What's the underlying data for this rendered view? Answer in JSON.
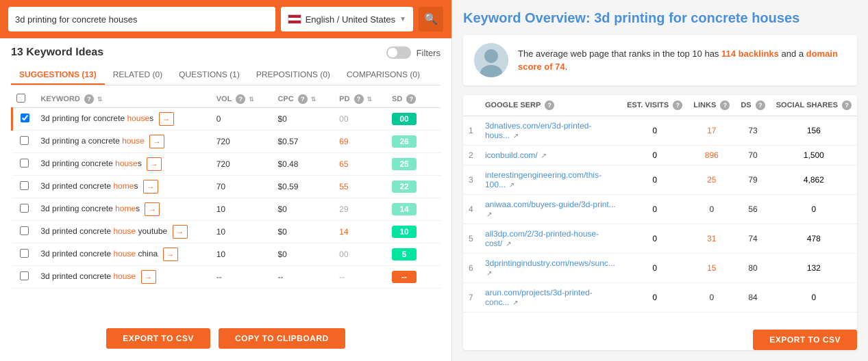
{
  "search": {
    "query": "3d printing for concrete houses",
    "lang": "English / United States",
    "placeholder": "3d printing for concrete houses"
  },
  "left": {
    "keyword_count": "13 Keyword Ideas",
    "filters_label": "Filters",
    "tabs": [
      {
        "id": "suggestions",
        "label": "SUGGESTIONS (13)",
        "active": true
      },
      {
        "id": "related",
        "label": "RELATED (0)",
        "active": false
      },
      {
        "id": "questions",
        "label": "QUESTIONS (1)",
        "active": false
      },
      {
        "id": "prepositions",
        "label": "PREPOSITIONS (0)",
        "active": false
      },
      {
        "id": "comparisons",
        "label": "COMPARISONS (0)",
        "active": false
      }
    ],
    "table_headers": [
      {
        "id": "keyword",
        "label": "KEYWORD"
      },
      {
        "id": "vol",
        "label": "VOL"
      },
      {
        "id": "cpc",
        "label": "CPC"
      },
      {
        "id": "pd",
        "label": "PD"
      },
      {
        "id": "sd",
        "label": "SD"
      }
    ],
    "rows": [
      {
        "keyword": "3d printing for concrete houses",
        "vol": "0",
        "cpc": "$0",
        "pd": "00",
        "sd": "00",
        "pd_style": "gray",
        "sd_style": "teal",
        "selected": true,
        "active_row": true
      },
      {
        "keyword": "3d printing a concrete house",
        "vol": "720",
        "cpc": "$0.57",
        "pd": "69",
        "sd": "26",
        "pd_style": "orange",
        "sd_style": "light-teal"
      },
      {
        "keyword": "3d printing concrete houses",
        "vol": "720",
        "cpc": "$0.48",
        "pd": "65",
        "sd": "25",
        "pd_style": "orange",
        "sd_style": "light-teal"
      },
      {
        "keyword": "3d printed concrete homes",
        "vol": "70",
        "cpc": "$0.59",
        "pd": "55",
        "sd": "22",
        "pd_style": "orange",
        "sd_style": "light-teal"
      },
      {
        "keyword": "3d printing concrete homes",
        "vol": "10",
        "cpc": "$0",
        "pd": "29",
        "sd": "14",
        "pd_style": "gray",
        "sd_style": "light-teal"
      },
      {
        "keyword": "3d printed concrete house youtube",
        "vol": "10",
        "cpc": "$0",
        "pd": "14",
        "sd": "10",
        "pd_style": "orange",
        "sd_style": "teal-bright"
      },
      {
        "keyword": "3d printed concrete house china",
        "vol": "10",
        "cpc": "$0",
        "pd": "00",
        "sd": "5",
        "pd_style": "gray",
        "sd_style": "teal-bright"
      },
      {
        "keyword": "3d printed concrete house",
        "vol": "--",
        "cpc": "--",
        "pd": "--",
        "sd": "--",
        "pd_style": "gray",
        "sd_style": "orange"
      }
    ],
    "export_csv": "EXPORT TO CSV",
    "copy_clipboard": "COPY TO CLIPBOARD"
  },
  "right": {
    "title_static": "Keyword Overview:",
    "title_keyword": "3d printing for concrete houses",
    "overview_text": "The average web page that ranks in the top 10 has",
    "backlinks_count": "114 backlinks",
    "domain_score_text": "and a",
    "domain_score": "domain score of 74",
    "serp_headers": [
      {
        "id": "google_serp",
        "label": "GOOGLE SERP"
      },
      {
        "id": "est_visits",
        "label": "EST. VISITS"
      },
      {
        "id": "links",
        "label": "LINKS"
      },
      {
        "id": "ds",
        "label": "DS"
      },
      {
        "id": "social_shares",
        "label": "SOCIAL SHARES"
      }
    ],
    "serp_rows": [
      {
        "rank": "1",
        "url": "3dnatives.com/en/3d-printed-hous...",
        "visits": "0",
        "links": "17",
        "links_orange": true,
        "ds": "73",
        "social": "156"
      },
      {
        "rank": "2",
        "url": "iconbuild.com/",
        "visits": "0",
        "links": "896",
        "links_orange": true,
        "ds": "70",
        "social": "1,500"
      },
      {
        "rank": "3",
        "url": "interestingengineering.com/this-100...",
        "visits": "0",
        "links": "25",
        "links_orange": true,
        "ds": "79",
        "social": "4,862"
      },
      {
        "rank": "4",
        "url": "aniwaa.com/buyers-guide/3d-print...",
        "visits": "0",
        "links": "0",
        "links_orange": false,
        "ds": "56",
        "social": "0"
      },
      {
        "rank": "5",
        "url": "all3dp.com/2/3d-printed-house-cost/",
        "visits": "0",
        "links": "31",
        "links_orange": true,
        "ds": "74",
        "social": "478"
      },
      {
        "rank": "6",
        "url": "3dprintingindustry.com/news/sunc...",
        "visits": "0",
        "links": "15",
        "links_orange": true,
        "ds": "80",
        "social": "132"
      },
      {
        "rank": "7",
        "url": "arun.com/projects/3d-printed-conc...",
        "visits": "0",
        "links": "0",
        "links_orange": false,
        "ds": "84",
        "social": "0"
      }
    ],
    "export_csv": "EXPORT TO CSV"
  }
}
